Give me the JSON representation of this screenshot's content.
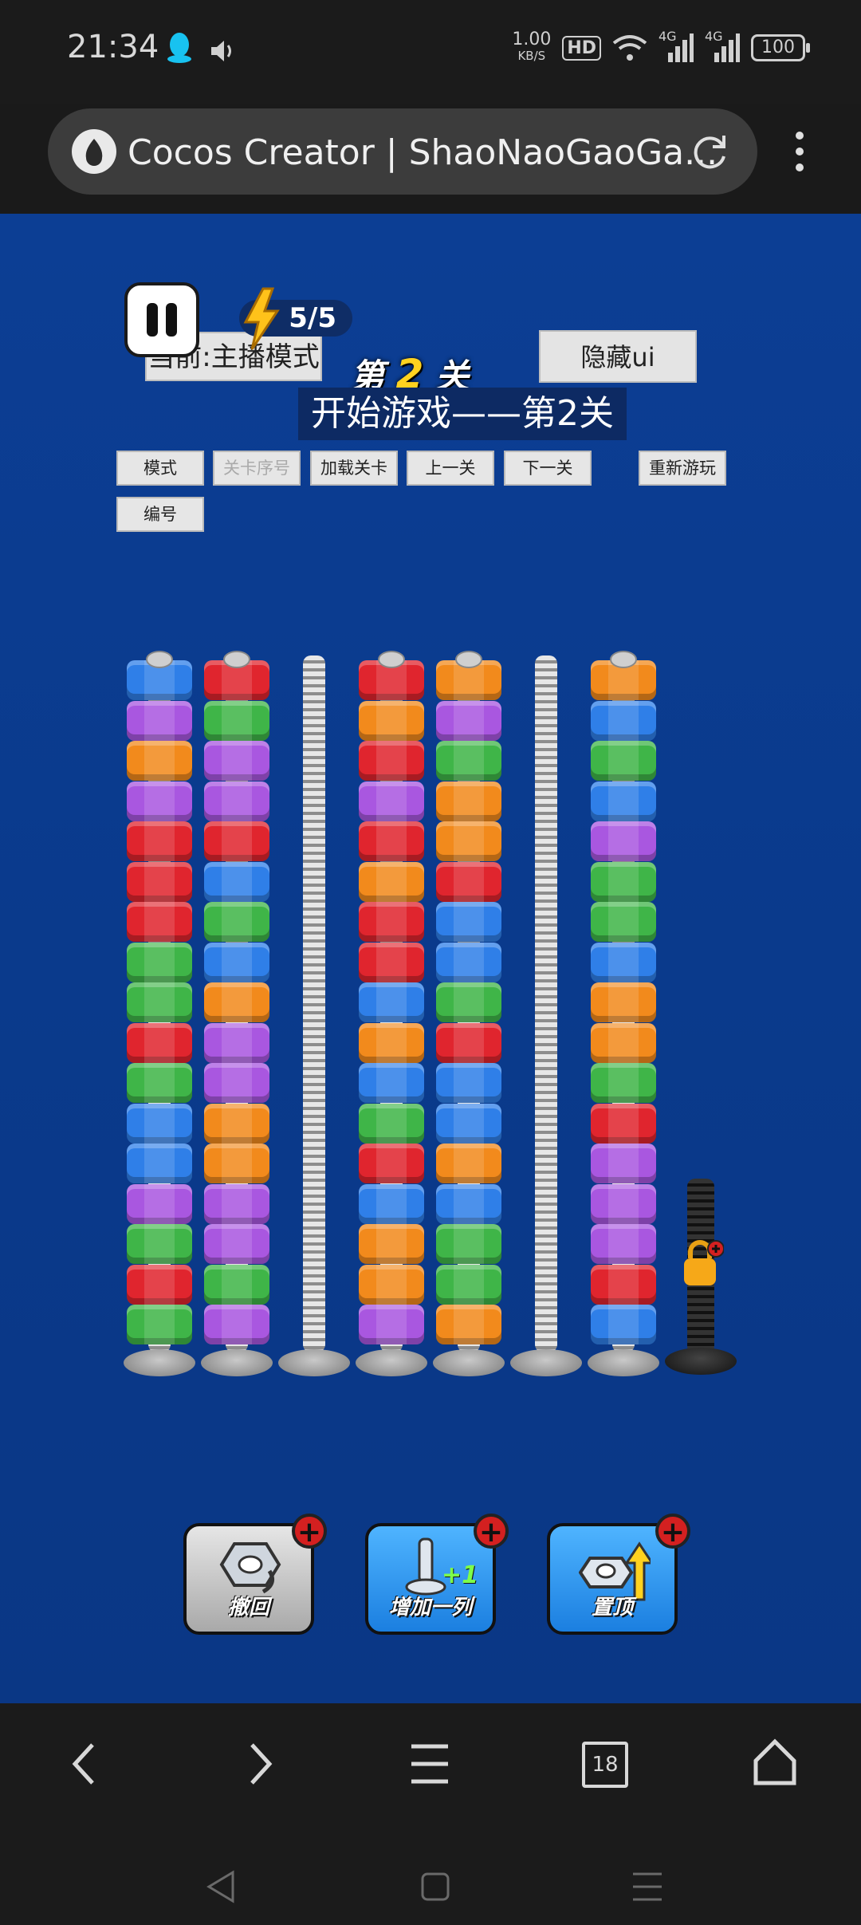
{
  "status": {
    "time": "21:34",
    "speed_value": "1.00",
    "speed_unit": "KB/S",
    "hd": "HD",
    "net1": "4G",
    "net2": "4G",
    "battery": "100"
  },
  "browser": {
    "title": "Cocos Creator | ShaoNaoGaoGa..."
  },
  "game": {
    "energy": "5/5",
    "mode_label": "当前:主播模式",
    "hide_ui": "隐藏ui",
    "level_prefix": "第",
    "level_num": "2",
    "level_suffix": "关",
    "start_label": "开始游戏——第2关",
    "buttons": {
      "mode": "模式",
      "level_index": "关卡序号",
      "load_level": "加载关卡",
      "prev": "上一关",
      "next": "下一关",
      "restart": "重新游玩",
      "number": "编号"
    },
    "power_ups": [
      {
        "label": "撤回"
      },
      {
        "label": "增加一列",
        "badge": "+1"
      },
      {
        "label": "置顶"
      }
    ],
    "colors": {
      "blue": "#2f7fe8",
      "purple": "#a957e0",
      "orange": "#f28a1c",
      "red": "#e0252e",
      "green": "#3fb548"
    },
    "columns": [
      [
        "blue",
        "purple",
        "orange",
        "purple",
        "red",
        "red",
        "red",
        "green",
        "green",
        "red",
        "green",
        "blue",
        "blue",
        "purple",
        "green",
        "red",
        "green"
      ],
      [
        "red",
        "green",
        "purple",
        "purple",
        "red",
        "blue",
        "green",
        "blue",
        "orange",
        "purple",
        "purple",
        "orange",
        "orange",
        "purple",
        "purple",
        "green",
        "purple"
      ],
      [],
      [
        "red",
        "orange",
        "red",
        "purple",
        "red",
        "orange",
        "red",
        "red",
        "blue",
        "orange",
        "blue",
        "green",
        "red",
        "blue",
        "orange",
        "orange",
        "purple"
      ],
      [
        "orange",
        "purple",
        "green",
        "orange",
        "orange",
        "red",
        "blue",
        "blue",
        "green",
        "red",
        "blue",
        "blue",
        "orange",
        "blue",
        "green",
        "green",
        "orange"
      ],
      [],
      [
        "orange",
        "blue",
        "green",
        "blue",
        "purple",
        "green",
        "green",
        "blue",
        "orange",
        "orange",
        "green",
        "red",
        "purple",
        "purple",
        "purple",
        "red",
        "blue"
      ]
    ]
  },
  "nav": {
    "tabs_count": "18"
  }
}
